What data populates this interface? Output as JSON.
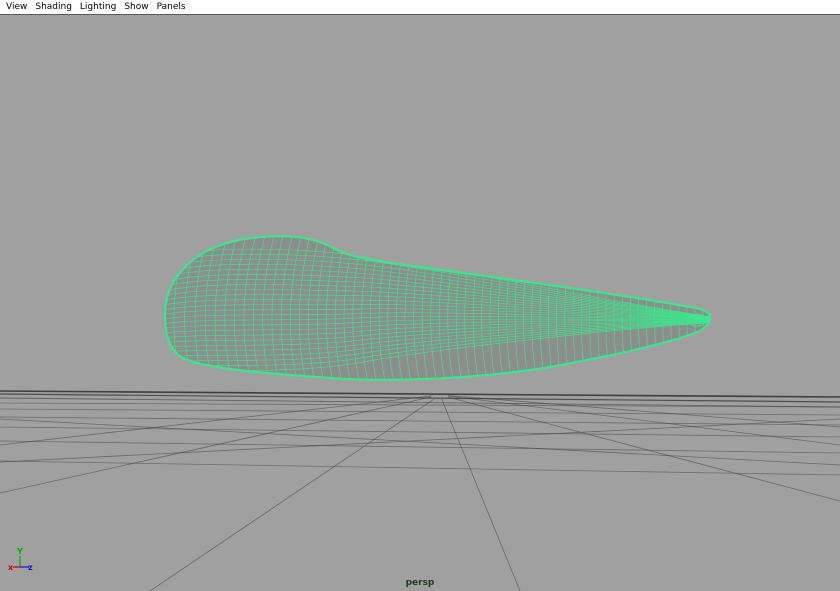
{
  "menu": {
    "items": [
      "View",
      "Shading",
      "Lighting",
      "Show",
      "Panels"
    ]
  },
  "viewport": {
    "camera_label": "persp",
    "background_color": "#a0a0a0",
    "wireframe_color": "#3ee58d",
    "grid_color": "#3a3a3a",
    "axis": {
      "x_label": "x",
      "y_label": "Y",
      "z_label": "z",
      "x_color": "#cc0000",
      "y_color": "#00b000",
      "z_color": "#1010d0"
    }
  }
}
